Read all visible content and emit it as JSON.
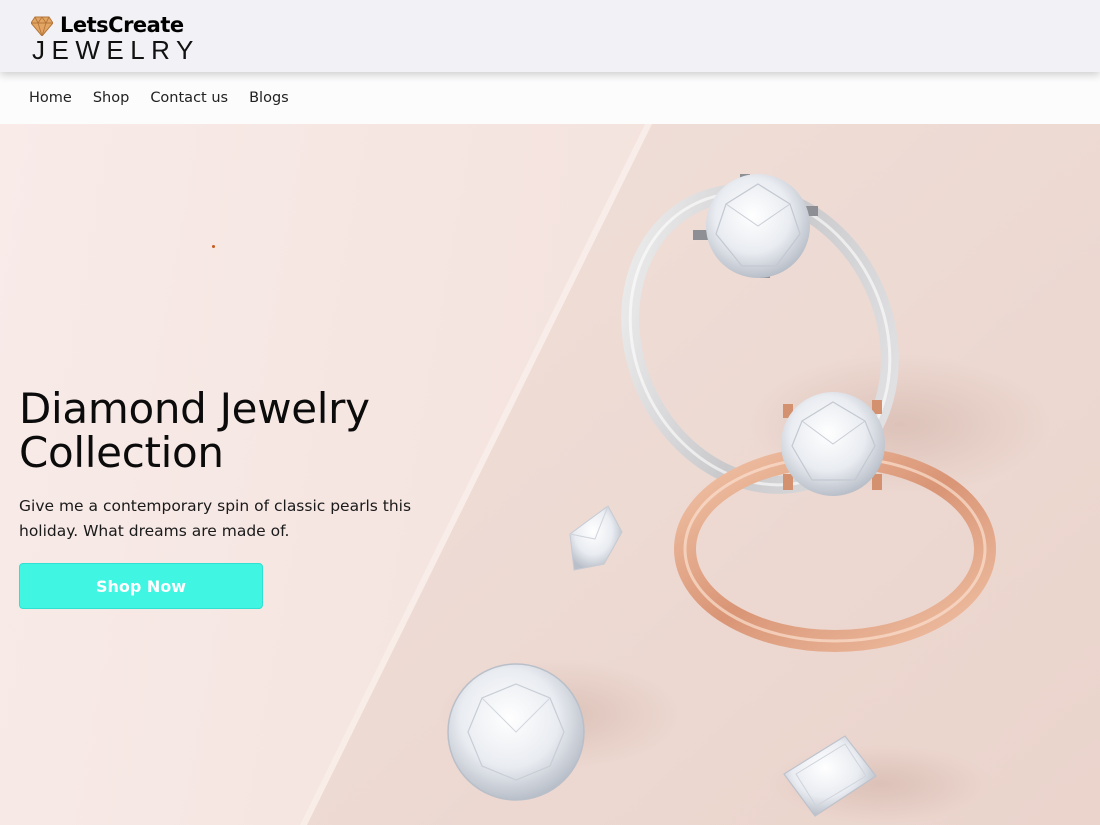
{
  "brand": {
    "name": "LetsCreate",
    "subtitle": "JEWELRY",
    "gem_color": "#e0a060"
  },
  "nav": {
    "items": [
      {
        "label": "Home"
      },
      {
        "label": "Shop"
      },
      {
        "label": "Contact us"
      },
      {
        "label": "Blogs"
      }
    ]
  },
  "hero": {
    "title": "Diamond Jewelry Collection",
    "subtitle": "Give me a contemporary spin of classic pearls this holiday. What dreams are made of.",
    "cta_label": "Shop Now",
    "cta_color": "#40f5e2",
    "background_color": "#f4e3de"
  }
}
